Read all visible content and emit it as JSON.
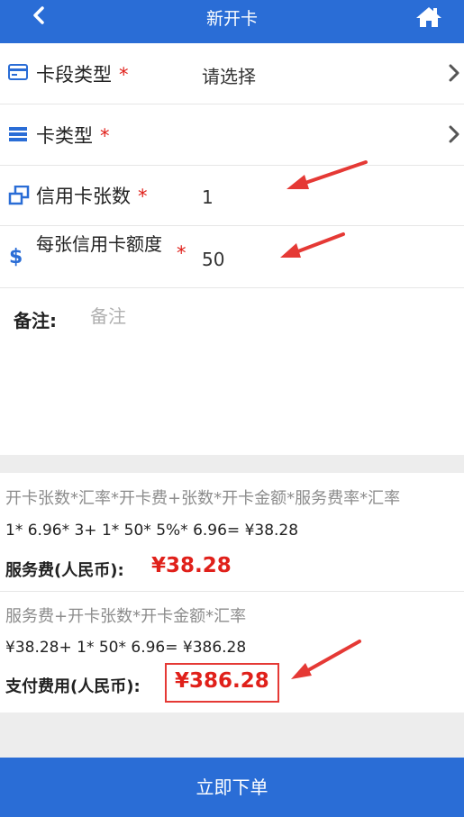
{
  "header": {
    "title": "新开卡"
  },
  "form": {
    "card_segment": {
      "label": "卡段类型",
      "required_mark": "*",
      "value": "请选择"
    },
    "card_type": {
      "label": "卡类型",
      "required_mark": "*"
    },
    "card_count": {
      "label": "信用卡张数",
      "required_mark": "*",
      "value": "1"
    },
    "card_limit": {
      "label": "每张信用卡额度",
      "required_mark": "*",
      "value": "50"
    },
    "remark": {
      "label": "备注:",
      "placeholder": "备注"
    }
  },
  "calculation": {
    "service_fee": {
      "formula": "开卡张数*汇率*开卡费+张数*开卡金额*服务费率*汇率",
      "expression": "1* 6.96* 3+ 1* 50* 5%* 6.96= ¥38.28",
      "label": "服务费(人民币):",
      "value": "¥38.28"
    },
    "payment": {
      "formula": "服务费+开卡张数*开卡金额*汇率",
      "expression": "¥38.28+ 1* 50* 6.96= ¥386.28",
      "label": "支付费用(人民币):",
      "value": "¥386.28"
    }
  },
  "footer": {
    "submit_label": "立即下单"
  },
  "colors": {
    "primary_blue": "#2a6dd6",
    "accent_red": "#e0201a",
    "annotation_red": "#e53935"
  }
}
